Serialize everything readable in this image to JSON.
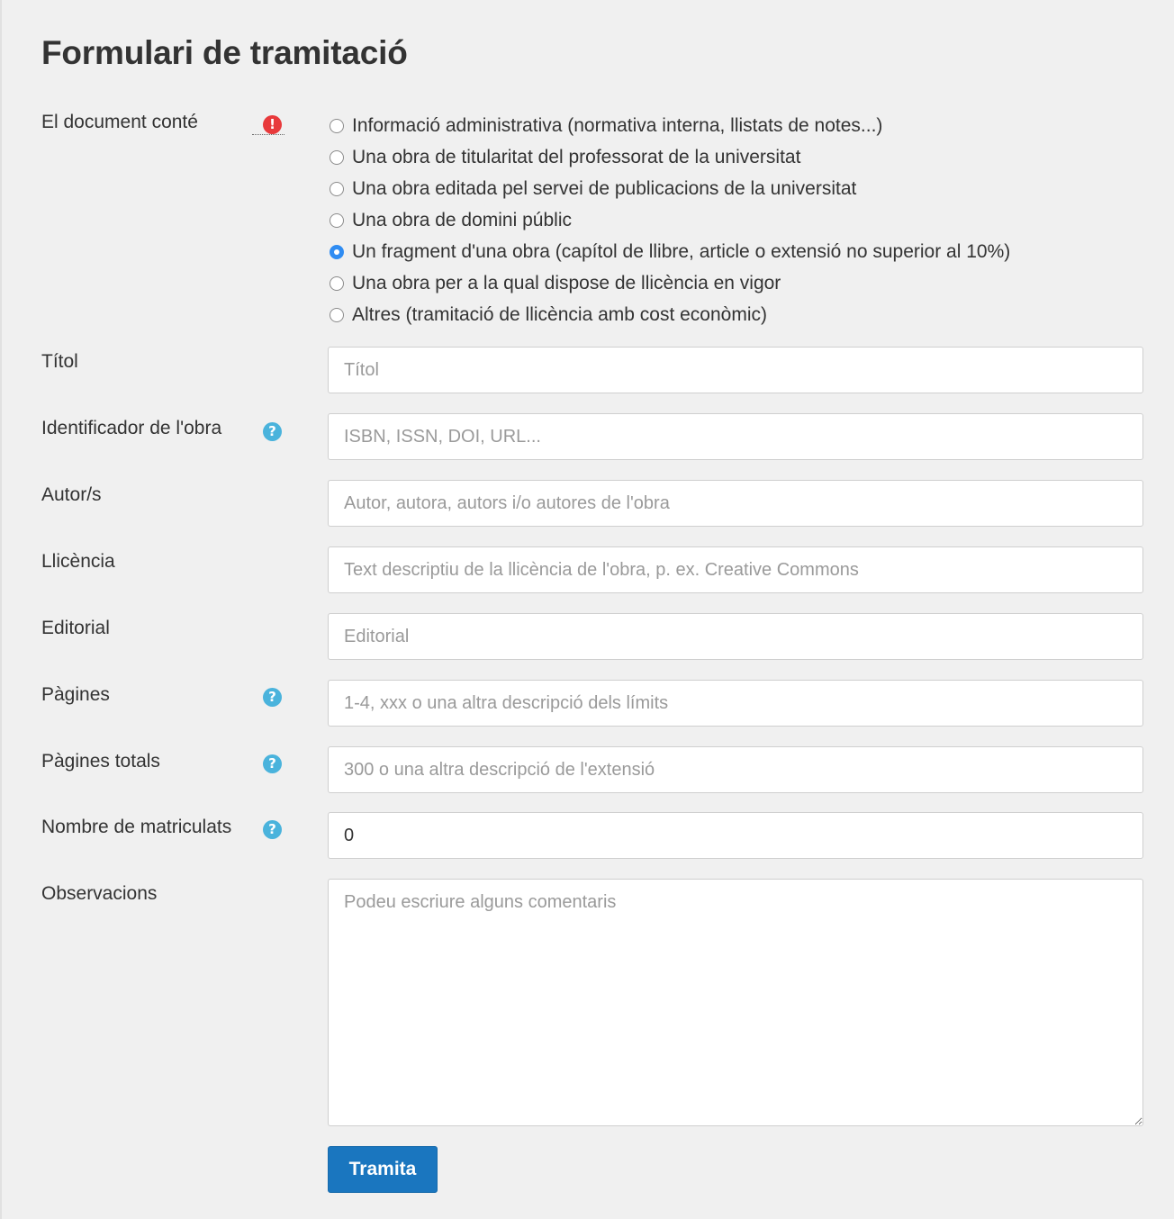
{
  "page": {
    "title": "Formulari de tramitació"
  },
  "form": {
    "document_type": {
      "label": "El document conté",
      "required_icon": "!",
      "options": [
        "Informació administrativa (normativa interna, llistats de notes...)",
        "Una obra de titularitat del professorat de la universitat",
        "Una obra editada pel servei de publicacions de la universitat",
        "Una obra de domini públic",
        "Un fragment d'una obra (capítol de llibre, article o extensió no superior al 10%)",
        "Una obra per a la qual dispose de llicència en vigor",
        "Altres (tramitació de llicència amb cost econòmic)"
      ],
      "selected_index": 4
    },
    "fields": {
      "titol": {
        "label": "Títol",
        "placeholder": "Títol",
        "value": ""
      },
      "identificador": {
        "label": "Identificador de l'obra",
        "placeholder": "ISBN, ISSN, DOI, URL...",
        "value": "",
        "help_icon": "?"
      },
      "autors": {
        "label": "Autor/s",
        "placeholder": "Autor, autora, autors i/o autores de l'obra",
        "value": ""
      },
      "llicencia": {
        "label": "Llicència",
        "placeholder": "Text descriptiu de la llicència de l'obra, p. ex. Creative Commons",
        "value": ""
      },
      "editorial": {
        "label": "Editorial",
        "placeholder": "Editorial",
        "value": ""
      },
      "pagines": {
        "label": "Pàgines",
        "placeholder": "1-4, xxx o una altra descripció dels límits",
        "value": "",
        "help_icon": "?"
      },
      "pagines_totals": {
        "label": "Pàgines totals",
        "placeholder": "300 o una altra descripció de l'extensió",
        "value": "",
        "help_icon": "?"
      },
      "matriculats": {
        "label": "Nombre de matriculats",
        "placeholder": "",
        "value": "0",
        "help_icon": "?"
      },
      "observacions": {
        "label": "Observacions",
        "placeholder": "Podeu escriure alguns comentaris",
        "value": ""
      }
    },
    "submit_label": "Tramita"
  },
  "colors": {
    "background": "#f0f0f0",
    "primary_button": "#1a76bf",
    "required_icon": "#e8393b",
    "help_icon": "#4ab3dc",
    "radio_checked": "#2f8cf2"
  },
  "icons": {
    "required": "exclamation-circle-icon",
    "help": "question-circle-icon"
  }
}
